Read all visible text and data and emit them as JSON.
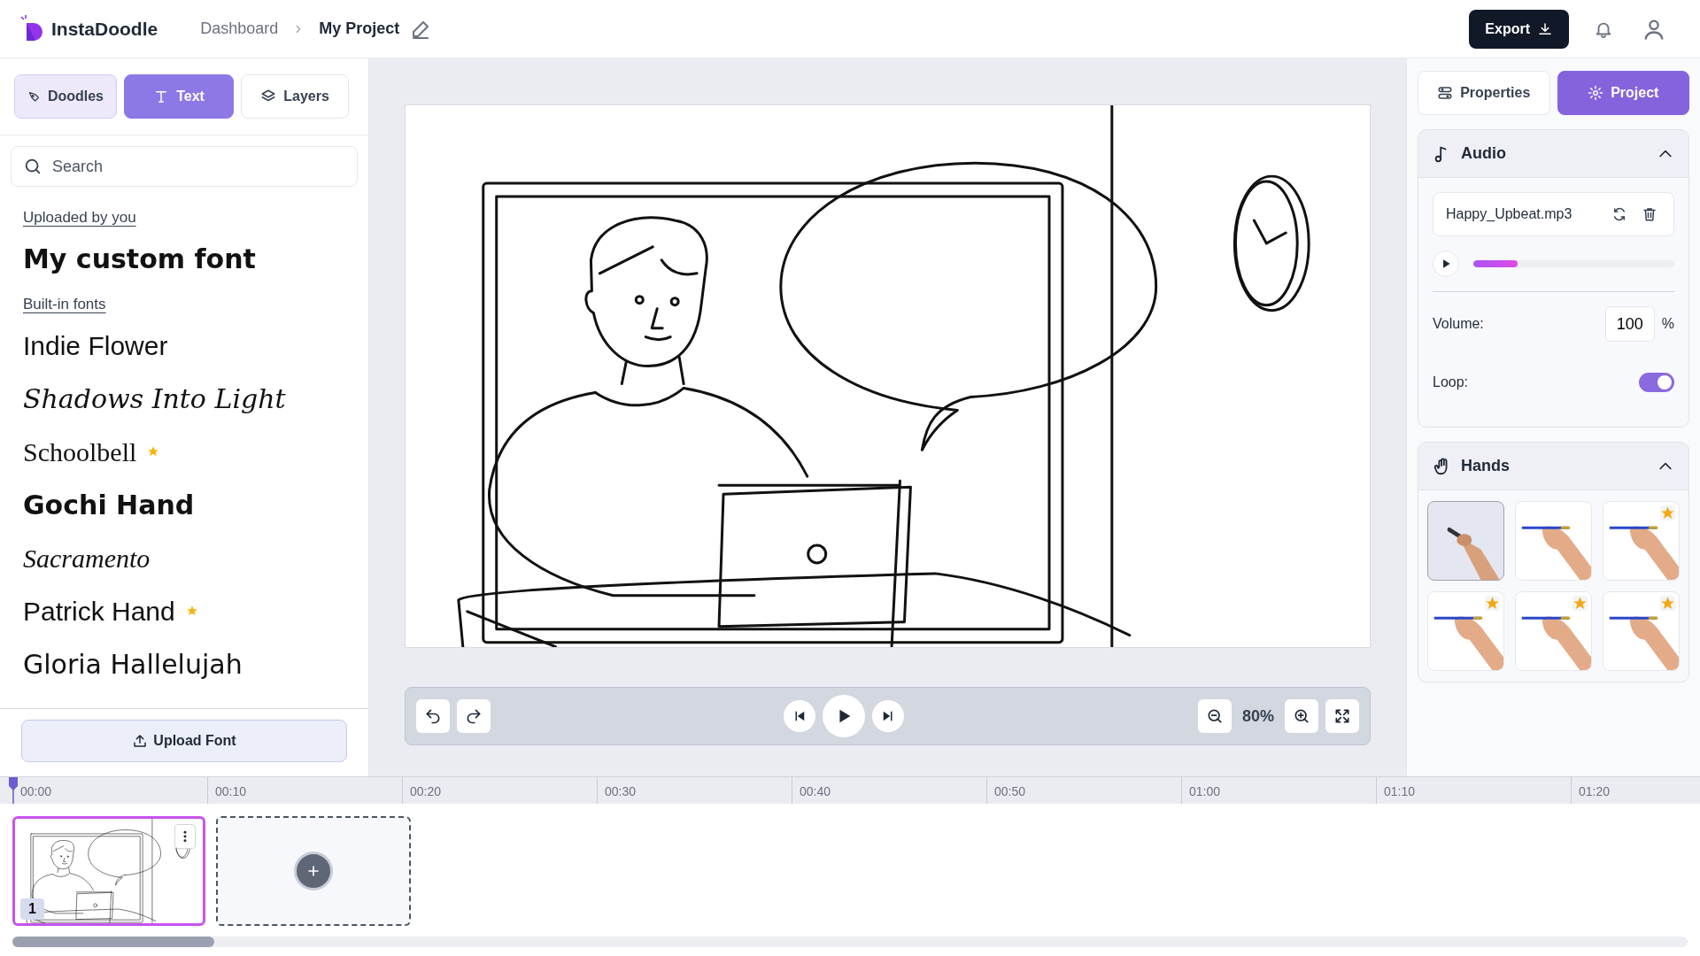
{
  "app": {
    "name": "InstaDoodle"
  },
  "breadcrumb": [
    {
      "label": "Dashboard"
    },
    {
      "label": "My Project"
    }
  ],
  "header": {
    "export_label": "Export"
  },
  "left_tabs": [
    {
      "label": "Doodles",
      "selected": false,
      "hovered": true
    },
    {
      "label": "Text",
      "selected": true,
      "hovered": false
    },
    {
      "label": "Layers",
      "selected": false,
      "hovered": false
    }
  ],
  "search": {
    "placeholder": "Search"
  },
  "font_sections": [
    {
      "title": "Uploaded by you",
      "fonts": [
        {
          "name": "My custom font",
          "premium": false
        }
      ]
    },
    {
      "title": "Built-in fonts",
      "fonts": [
        {
          "name": "Indie Flower",
          "premium": false
        },
        {
          "name": "Shadows Into Light",
          "premium": false
        },
        {
          "name": "Schoolbell",
          "premium": true
        },
        {
          "name": "Gochi Hand",
          "premium": false
        },
        {
          "name": "Sacramento",
          "premium": false
        },
        {
          "name": "Patrick Hand",
          "premium": true
        },
        {
          "name": "Gloria Hallelujah",
          "premium": false
        }
      ]
    }
  ],
  "upload_label": "Upload Font",
  "right_tabs": [
    {
      "label": "Properties",
      "selected": false
    },
    {
      "label": "Project",
      "selected": true
    }
  ],
  "audio": {
    "title": "Audio",
    "expanded": true,
    "file": "Happy_Upbeat.mp3",
    "level": 0.22,
    "volume_label": "Volume:",
    "volume": "100",
    "unit": "%",
    "loop_label": "Loop:",
    "loop": true
  },
  "hands": {
    "title": "Hands",
    "expanded": true,
    "items": [
      {
        "selected": true,
        "premium": false
      },
      {
        "selected": false,
        "premium": false
      },
      {
        "selected": false,
        "premium": true
      },
      {
        "selected": false,
        "premium": true
      },
      {
        "selected": false,
        "premium": true
      },
      {
        "selected": false,
        "premium": true
      }
    ]
  },
  "player": {
    "zoom": "80%"
  },
  "timeline": {
    "ticks": [
      "00:00",
      "00:10",
      "00:20",
      "00:30",
      "00:40",
      "00:50",
      "01:00",
      "01:10",
      "01:20"
    ],
    "scenes": [
      {
        "number": "1",
        "selected": true
      }
    ]
  }
}
